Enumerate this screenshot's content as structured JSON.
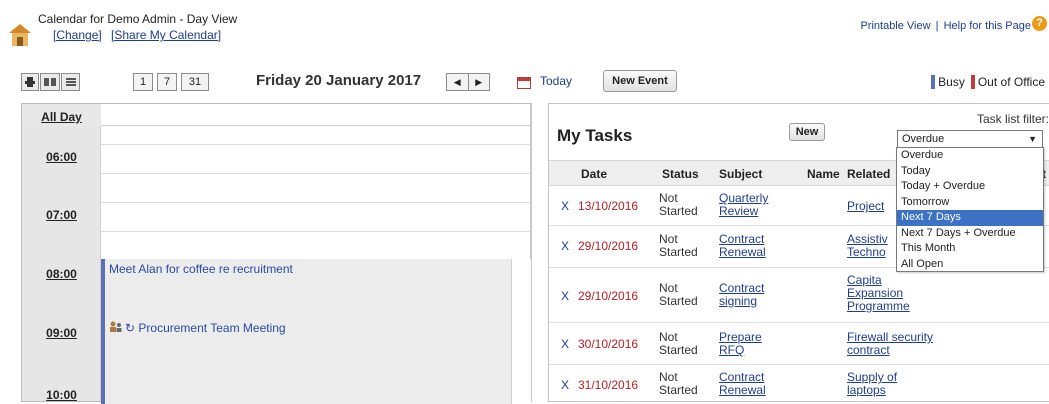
{
  "header": {
    "title": "Calendar for Demo Admin - Day View",
    "change_link": "[Change]",
    "share_link": "[Share My Calendar]",
    "printable_view": "Printable View",
    "separator": "|",
    "help_link": "Help for this Page",
    "help_icon_text": "?"
  },
  "toolbar": {
    "view_day": "1",
    "view_week": "7",
    "view_month": "31",
    "date_title": "Friday 20 January 2017",
    "prev": "◀",
    "next": "▶",
    "today": "Today",
    "new_event": "New Event",
    "legend": [
      {
        "label": "Busy",
        "color": "#5a6fb8"
      },
      {
        "label": "Out of Office",
        "color": "#c43b3b"
      }
    ]
  },
  "calendar": {
    "all_day": "All Day",
    "times": [
      "06:00",
      "07:00",
      "08:00",
      "09:00",
      "10:00"
    ],
    "events": [
      {
        "title": "Meet Alan for coffee re recruitment"
      },
      {
        "title": "Procurement Team Meeting"
      }
    ]
  },
  "tasks": {
    "title": "My Tasks",
    "new_button": "New",
    "filter_label": "Task list filter:",
    "filter_value": "Overdue",
    "filter_options": [
      "Overdue",
      "Today",
      "Today + Overdue",
      "Tomorrow",
      "Next 7 Days",
      "Next 7 Days + Overdue",
      "This Month",
      "All Open"
    ],
    "filter_highlighted": "Next 7 Days",
    "columns": [
      "Date",
      "Status",
      "Subject",
      "Name",
      "Related",
      "t"
    ],
    "rows": [
      {
        "del": "X",
        "date": "13/10/2016",
        "status1": "Not",
        "status2": "Started",
        "subject1": "Quarterly",
        "subject2": "Review",
        "related1": "Project",
        "related2": "",
        "related3": ""
      },
      {
        "del": "X",
        "date": "29/10/2016",
        "status1": "Not",
        "status2": "Started",
        "subject1": "Contract",
        "subject2": "Renewal",
        "related1": "Assistiv",
        "related2": "Techno",
        "related3": ""
      },
      {
        "del": "X",
        "date": "29/10/2016",
        "status1": "Not",
        "status2": "Started",
        "subject1": "Contract",
        "subject2": "signing",
        "related1": "Capita",
        "related2": "Expansion",
        "related3": "Programme"
      },
      {
        "del": "X",
        "date": "30/10/2016",
        "status1": "Not",
        "status2": "Started",
        "subject1": "Prepare",
        "subject2": "RFQ",
        "related1": "Firewall security",
        "related2": "contract",
        "related3": ""
      },
      {
        "del": "X",
        "date": "31/10/2016",
        "status1": "Not",
        "status2": "Started",
        "subject1": "Contract",
        "subject2": "Renewal",
        "related1": "Supply of",
        "related2": "laptops",
        "related3": ""
      }
    ]
  }
}
